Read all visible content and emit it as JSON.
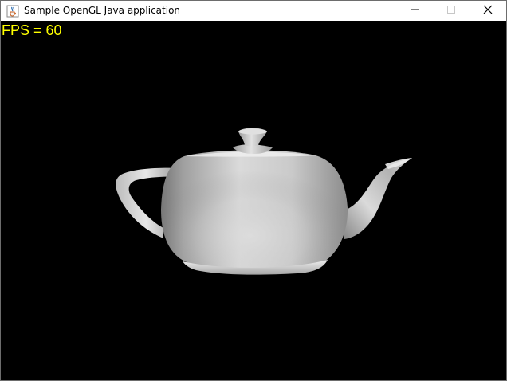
{
  "window": {
    "title": "Sample OpenGL Java application",
    "app_icon": "java-cup-icon",
    "controls": {
      "minimize_icon": "minimize-icon",
      "maximize_icon": "maximize-icon",
      "close_icon": "close-icon"
    }
  },
  "canvas": {
    "fps_text": "FPS = 60",
    "fps_color": "#ffff00",
    "background_color": "#000000",
    "object_icon": "teapot-render"
  }
}
